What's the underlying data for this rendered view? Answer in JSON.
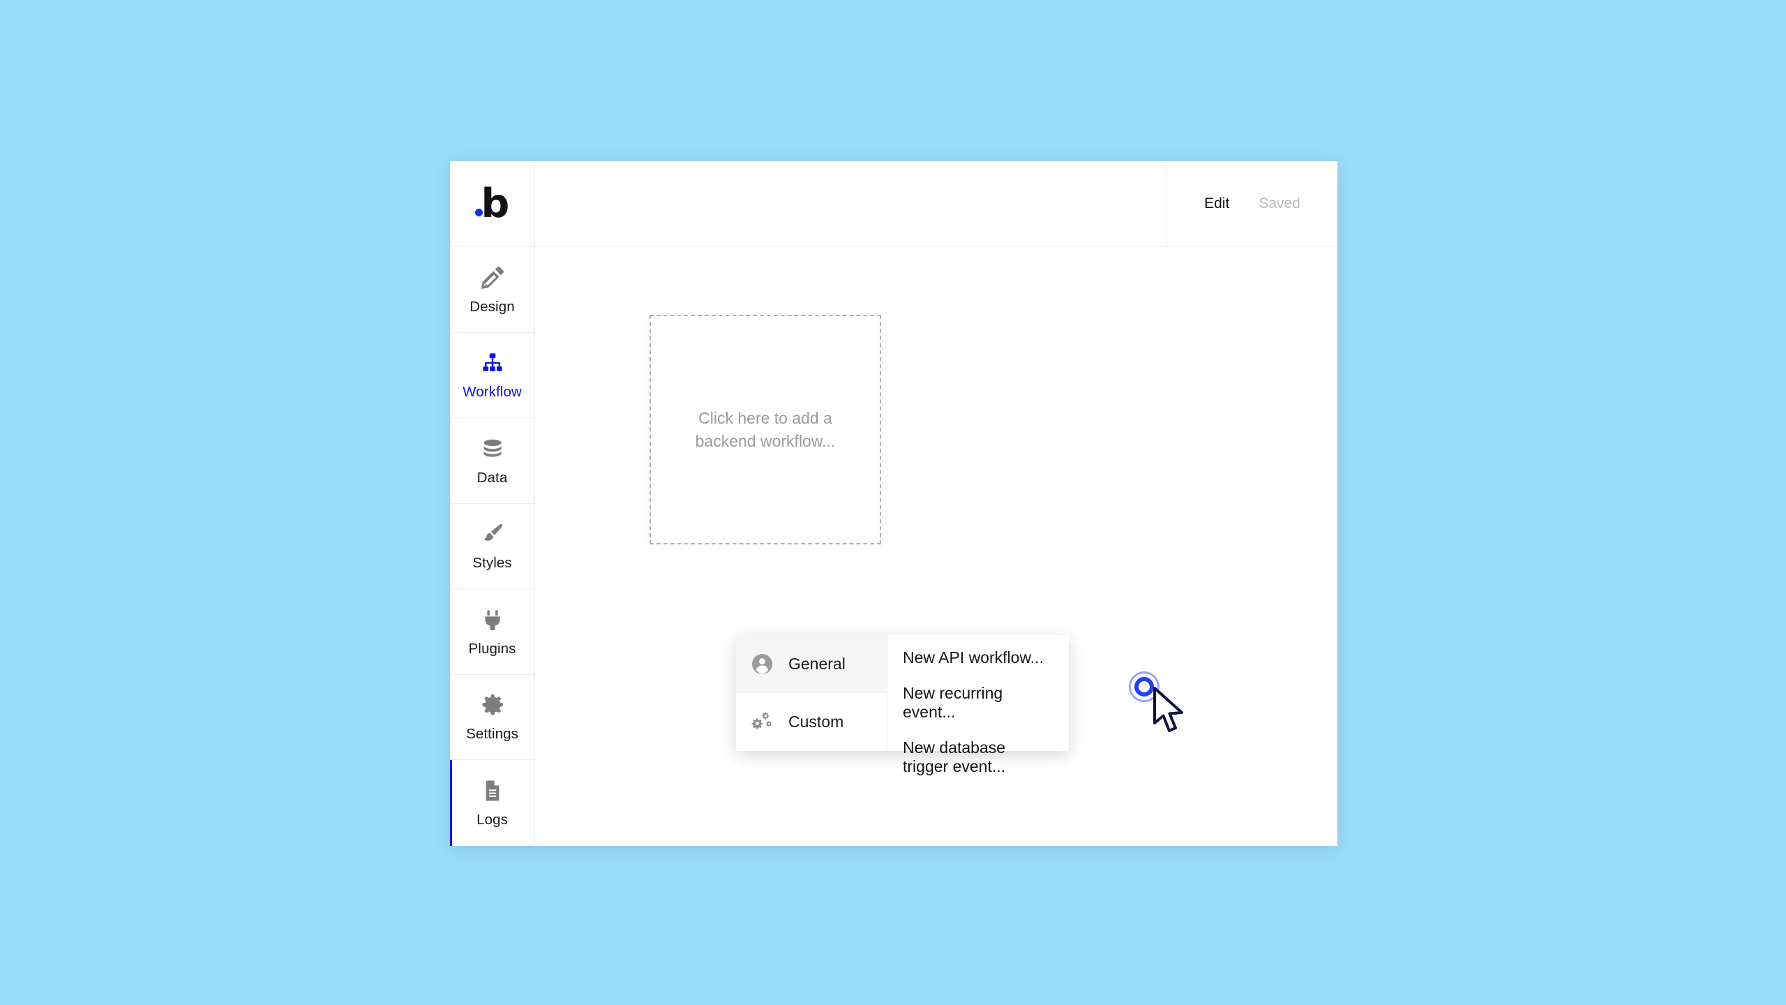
{
  "app": {
    "name": "Bubble editor",
    "background_color": "#9adcfb",
    "accent_color": "#1212e0"
  },
  "logo": {
    "letter": "b",
    "dot_color": "#0b36f0",
    "name": "bubble-logo"
  },
  "header": {
    "edit_label": "Edit",
    "saved_label": "Saved"
  },
  "sidebar": {
    "items": [
      {
        "label": "Design",
        "icon": "pencil-ruler-icon",
        "active": false,
        "accent": false
      },
      {
        "label": "Workflow",
        "icon": "sitemap-icon",
        "active": true,
        "accent": false
      },
      {
        "label": "Data",
        "icon": "database-icon",
        "active": false,
        "accent": false
      },
      {
        "label": "Styles",
        "icon": "paintbrush-icon",
        "active": false,
        "accent": false
      },
      {
        "label": "Plugins",
        "icon": "plug-icon",
        "active": false,
        "accent": false
      },
      {
        "label": "Settings",
        "icon": "gear-icon",
        "active": false,
        "accent": false
      },
      {
        "label": "Logs",
        "icon": "document-lines-icon",
        "active": false,
        "accent": true
      }
    ]
  },
  "canvas": {
    "add_workflow_placeholder": "Click here to add a backend workflow..."
  },
  "workflow_menu": {
    "categories": [
      {
        "label": "General",
        "icon": "user-circle-icon",
        "selected": true
      },
      {
        "label": "Custom",
        "icon": "gears-icon",
        "selected": false
      }
    ],
    "actions": [
      {
        "label": "New API workflow..."
      },
      {
        "label": "New recurring event..."
      },
      {
        "label": "New database trigger event..."
      }
    ]
  },
  "cursor": {
    "type": "arrow-pointer",
    "click_indicator": "click-ring"
  }
}
